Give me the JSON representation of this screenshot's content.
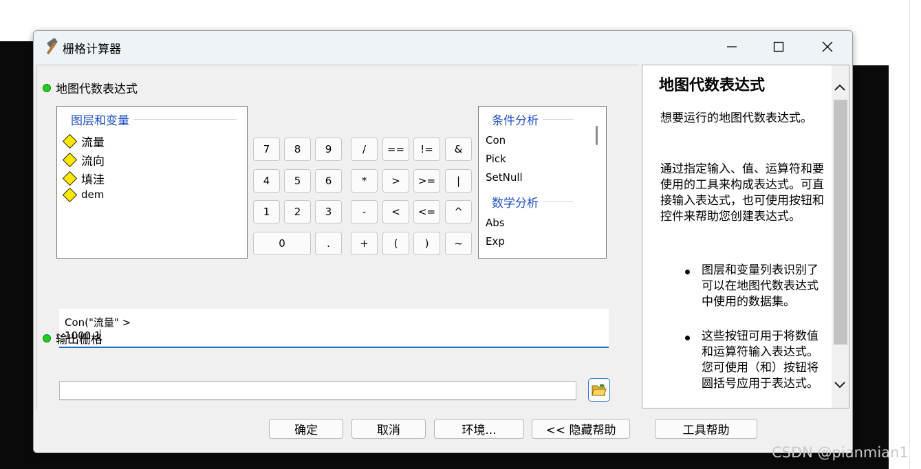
{
  "window": {
    "title": "栅格计算器",
    "icon": "hammer-icon"
  },
  "expression_section": {
    "label": "地图代数表达式"
  },
  "layers": {
    "header": "图层和变量",
    "items": [
      "流量",
      "流向",
      "填洼",
      "dem"
    ]
  },
  "calculator": {
    "rows": [
      [
        "7",
        "8",
        "9",
        "/",
        "==",
        "!=",
        "&"
      ],
      [
        "4",
        "5",
        "6",
        "*",
        ">",
        ">=",
        "|"
      ],
      [
        "1",
        "2",
        "3",
        "-",
        "<",
        "<=",
        "^"
      ],
      [
        "0",
        ".",
        "+",
        "(",
        ")",
        "~"
      ]
    ]
  },
  "functions": {
    "group1": "条件分析",
    "group1_items": [
      "Con",
      "Pick",
      "SetNull"
    ],
    "group2": "数学分析",
    "group2_items": [
      "Abs",
      "Exp"
    ]
  },
  "expression": {
    "value": "Con(\"流量\" > 1000,1"
  },
  "output_section": {
    "label": "输出栅格",
    "value": ""
  },
  "help": {
    "title": "地图代数表达式",
    "paragraph1": "想要运行的地图代数表达式。",
    "paragraph2": "通过指定输入、值、运算符和要使用的工具来构成表达式。可直接输入表达式，也可使用按钮和控件来帮助您创建表达式。",
    "bullet1": "图层和变量列表识别了可以在地图代数表达式中使用的数据集。",
    "bullet2": "这些按钮可用于将数值和运算符输入表达式。您可使用（和）按钮将圆括号应用于表达式。"
  },
  "footer": {
    "ok": "确定",
    "cancel": "取消",
    "env": "环境...",
    "hide_help": "<< 隐藏帮助",
    "tool_help": "工具帮助"
  },
  "watermark": "CSDN @pianmian1",
  "colors": {
    "accent": "#1f6fc8",
    "group_header": "#1c4fc0",
    "status_dot": "#22cc22",
    "layer_icon": "#ffe800"
  }
}
